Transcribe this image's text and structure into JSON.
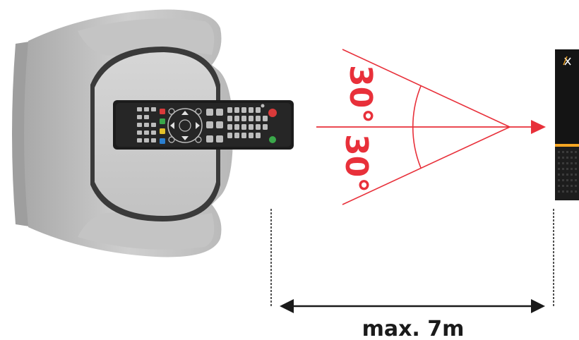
{
  "diagram": {
    "angle_top": "30°",
    "angle_bottom": "30°",
    "distance": "max. 7m",
    "device_brand": "X",
    "colors": {
      "beam": "#e8303a",
      "chair": "#c9c9c9",
      "device_accent": "#f5a623",
      "distance_arrow": "#1a1a1a"
    }
  }
}
